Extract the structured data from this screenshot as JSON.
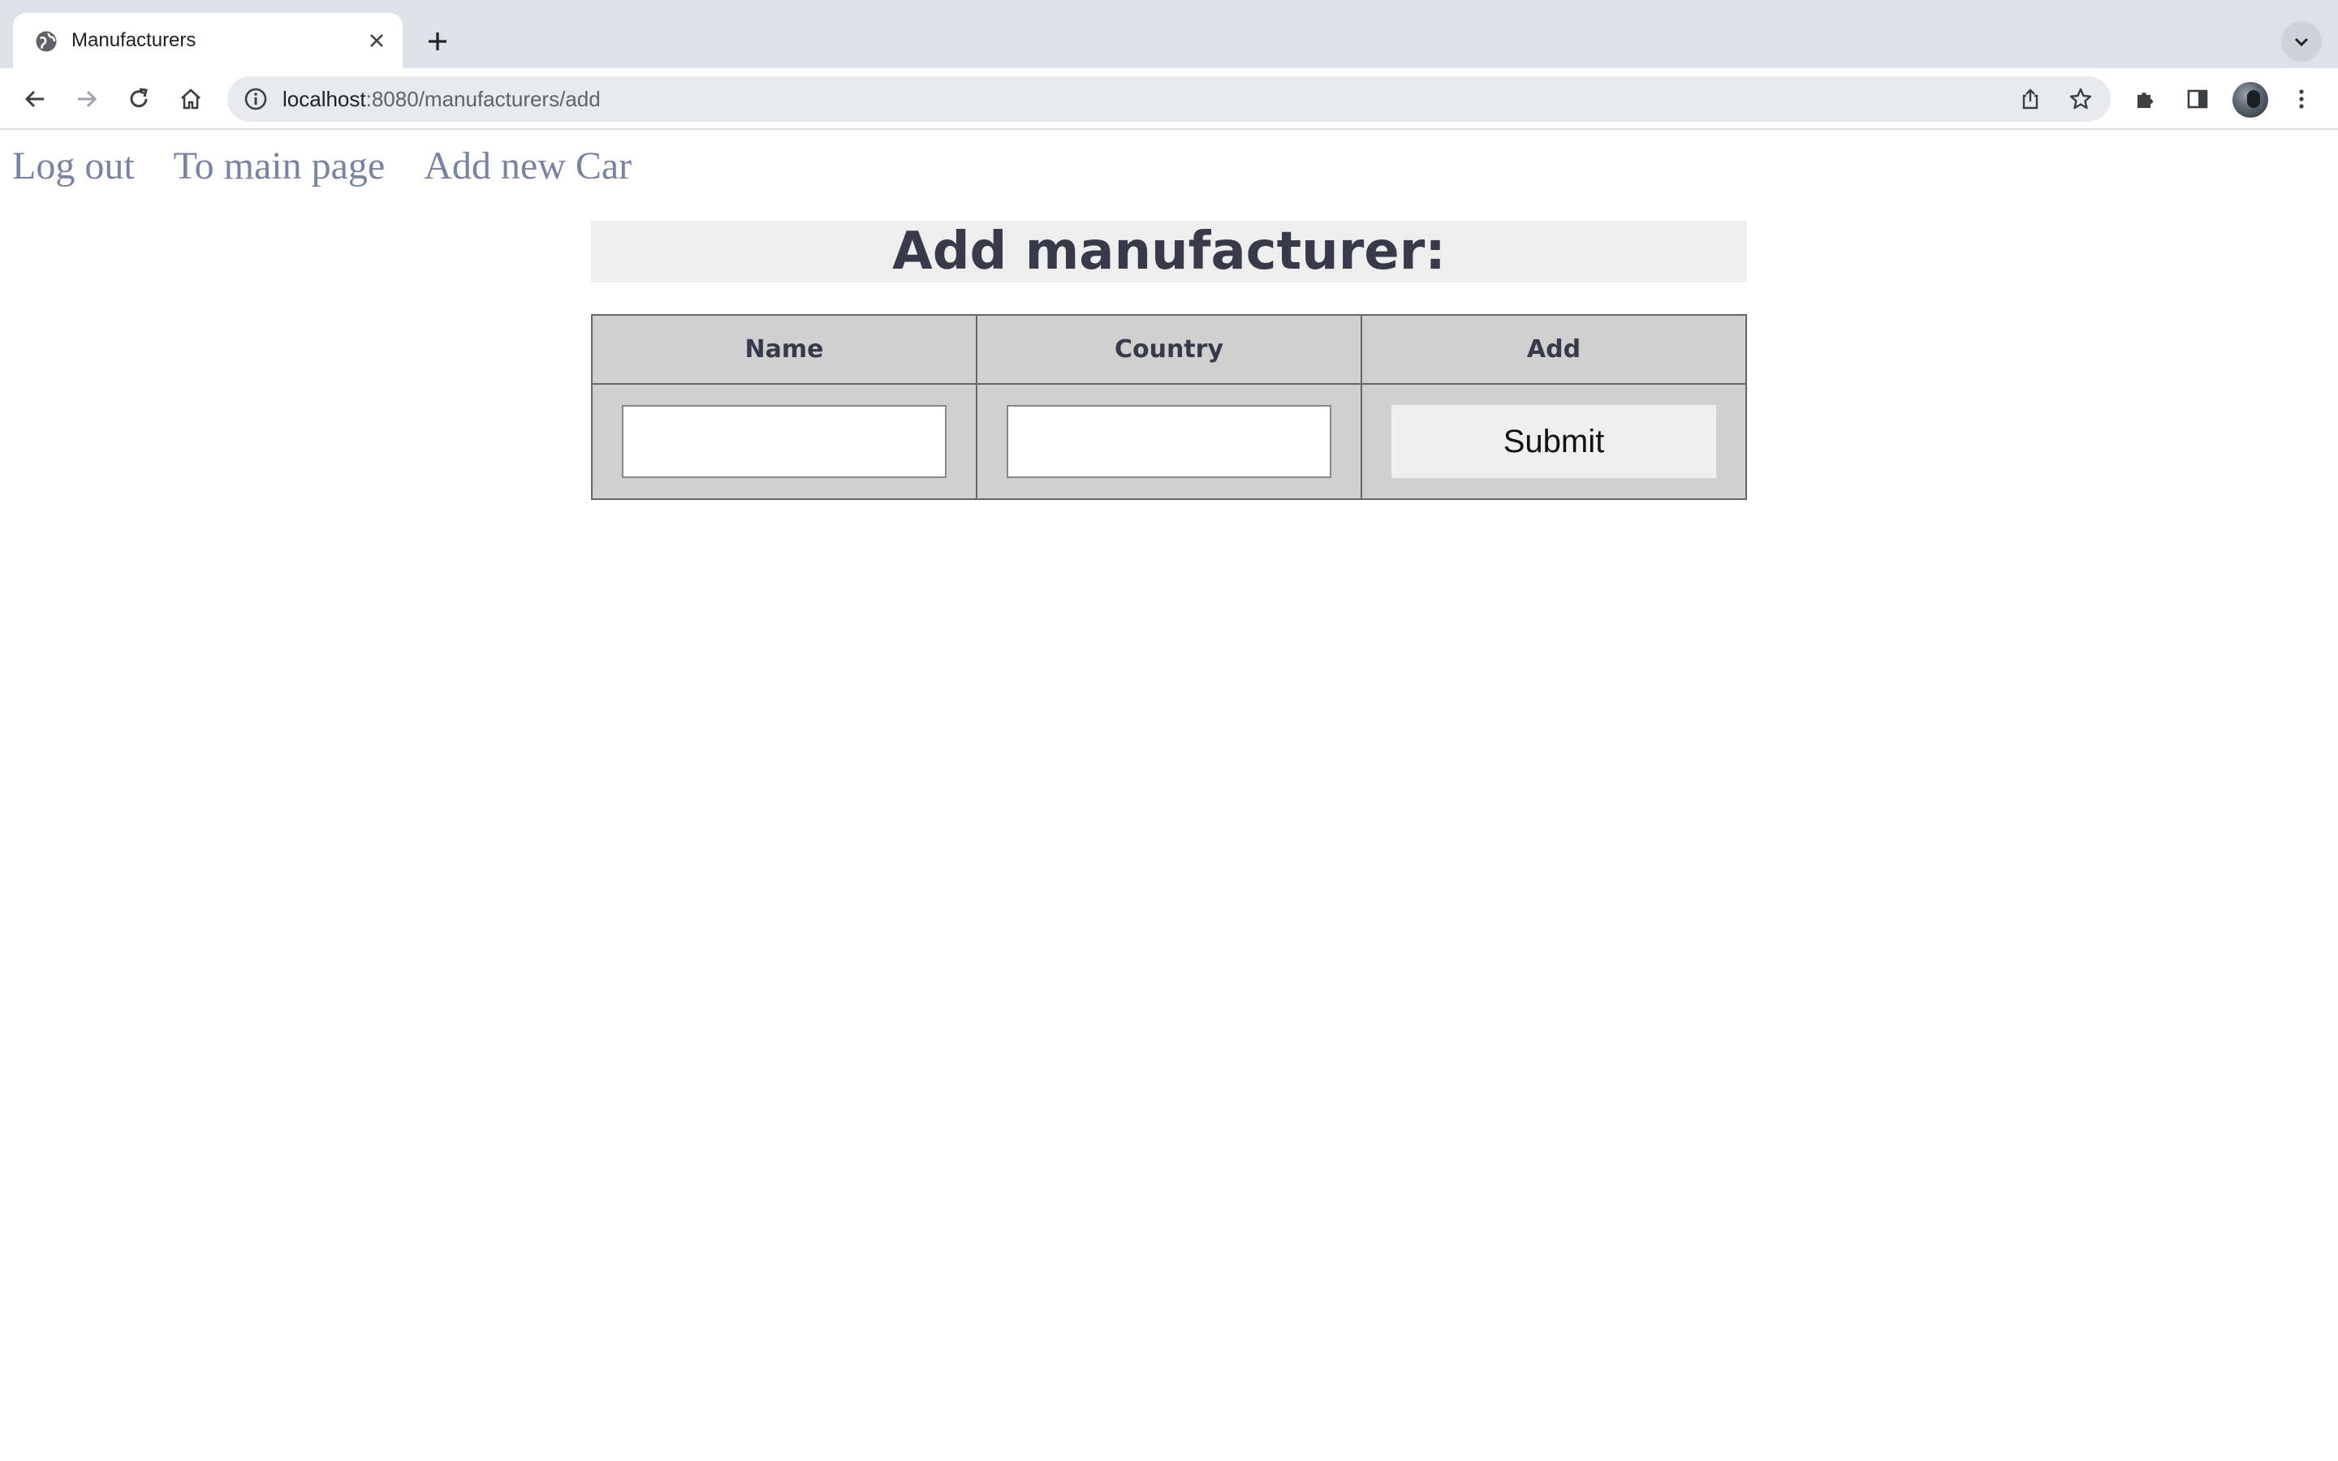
{
  "browser": {
    "tab_title": "Manufacturers",
    "url_host": "localhost",
    "url_rest": ":8080/manufacturers/add",
    "icons": {
      "favicon": "globe-icon",
      "close": "close-icon",
      "new_tab": "plus-icon",
      "tab_search": "chevron-down-icon",
      "back": "back-arrow-icon",
      "forward": "forward-arrow-icon",
      "reload": "reload-icon",
      "home": "home-icon",
      "site_info": "info-icon",
      "share": "share-icon",
      "bookmark": "star-icon",
      "extensions": "puzzle-icon",
      "side_panel": "side-panel-icon",
      "menu": "kebab-menu-icon"
    }
  },
  "nav": {
    "logout": "Log out",
    "main_page": "To main page",
    "add_car": "Add new Car"
  },
  "form": {
    "title": "Add manufacturer:",
    "columns": [
      "Name",
      "Country",
      "Add"
    ],
    "name_value": "",
    "country_value": "",
    "submit_label": "Submit"
  },
  "colors": {
    "link": "#7a83a0",
    "heading": "#383a4a",
    "table_bg": "#d0d0d0",
    "title_bg": "#eeeeee"
  }
}
